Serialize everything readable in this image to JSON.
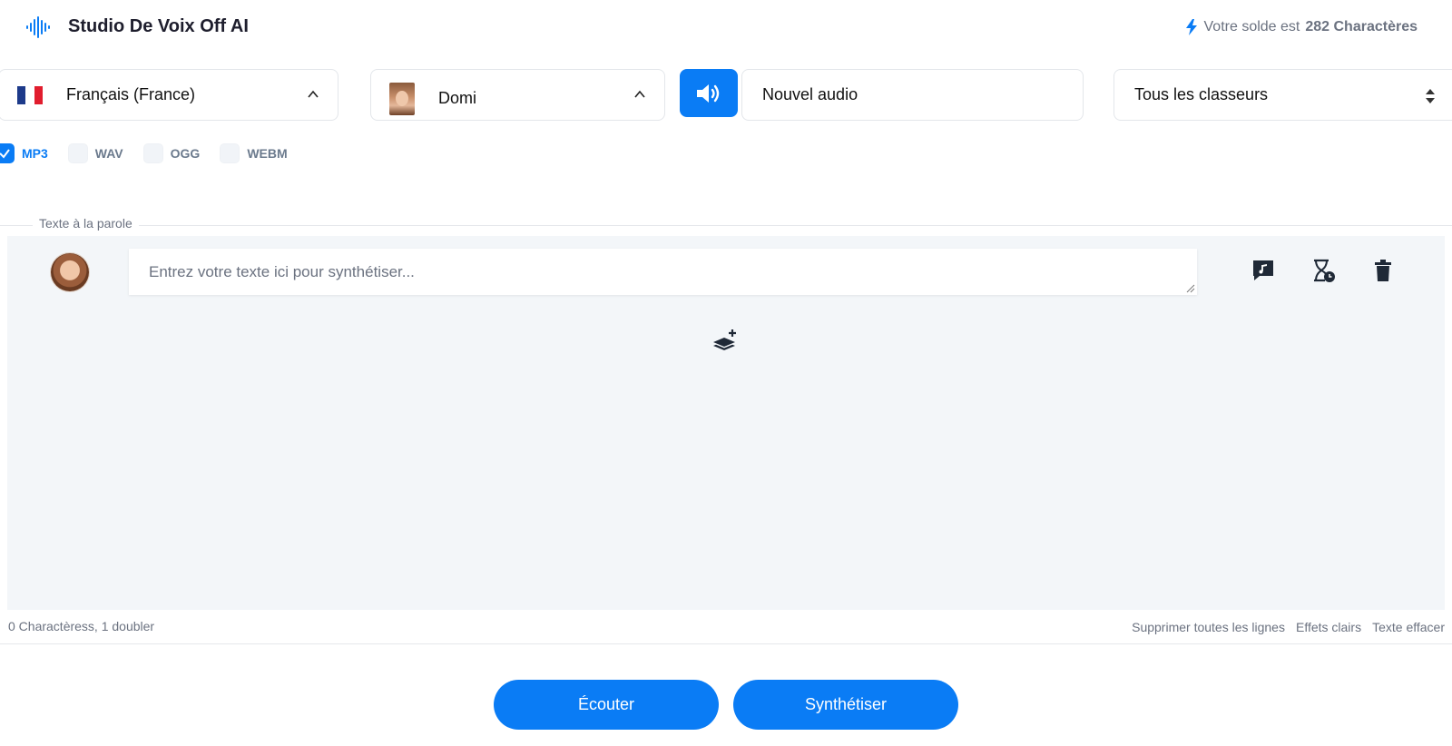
{
  "header": {
    "title": "Studio De Voix Off AI",
    "balance_prefix": "Votre solde est",
    "balance_value": "282 Charactères"
  },
  "controls": {
    "language": "Français (France)",
    "voice": "Domi",
    "audio_name": "Nouvel audio",
    "folder": "Tous les classeurs"
  },
  "formats": [
    {
      "label": "MP3",
      "checked": true
    },
    {
      "label": "WAV",
      "checked": false
    },
    {
      "label": "OGG",
      "checked": false
    },
    {
      "label": "WEBM",
      "checked": false
    }
  ],
  "editor": {
    "section_label": "Texte à la parole",
    "placeholder": "Entrez votre texte ici pour synthétiser..."
  },
  "footer": {
    "count": "0 Charactèress, 1 doubler",
    "links": {
      "delete_all": "Supprimer toutes les lignes",
      "clear_effects": "Effets clairs",
      "clear_text": "Texte effacer"
    }
  },
  "actions": {
    "listen": "Écouter",
    "synthesize": "Synthétiser"
  },
  "colors": {
    "accent": "#0a7cf5",
    "editor_bg": "#f3f6f9",
    "muted_text": "#6b7280"
  }
}
